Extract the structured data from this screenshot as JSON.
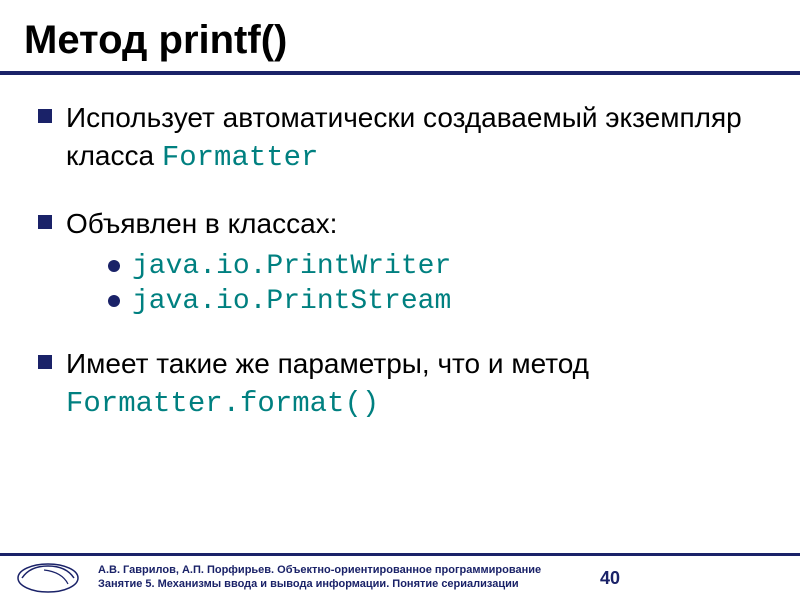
{
  "title": "Метод printf()",
  "bullets": {
    "b1_prefix": "Использует автоматически создаваемый экземпляр класса ",
    "b1_code": "Formatter",
    "b2": "Объявлен в классах:",
    "b2_sub": [
      "java.io.PrintWriter",
      "java.io.PrintStream"
    ],
    "b3_prefix": "Имеет такие же параметры, что и метод ",
    "b3_code": "Formatter.format()"
  },
  "footer": {
    "line1": "А.В. Гаврилов, А.П. Порфирьев. Объектно-ориентированное программирование",
    "line2": "Занятие 5. Механизмы ввода и вывода информации. Понятие сериализации"
  },
  "page_number": "40"
}
